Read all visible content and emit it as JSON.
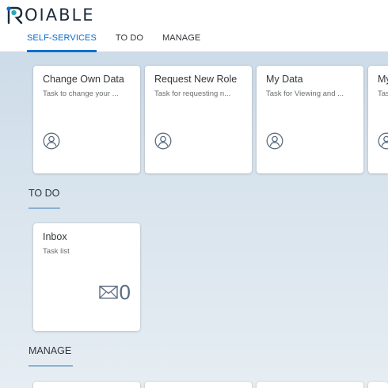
{
  "brand": {
    "logo_text": "OIABLE"
  },
  "tabs": [
    {
      "label": "SELF-SERVICES",
      "active": true
    },
    {
      "label": "TO DO",
      "active": false
    },
    {
      "label": "MANAGE",
      "active": false
    }
  ],
  "self_services": {
    "tiles": [
      {
        "title": "Change Own Data",
        "subtitle": "Task to change your ...",
        "icon": "user-icon"
      },
      {
        "title": "Request New Role",
        "subtitle": "Task for requesting n...",
        "icon": "user-icon"
      },
      {
        "title": "My Data",
        "subtitle": "Task for Viewing and ...",
        "icon": "user-icon"
      },
      {
        "title": "My",
        "subtitle": "Tas",
        "icon": "user-icon"
      }
    ]
  },
  "todo": {
    "heading": "TO DO",
    "inbox": {
      "title": "Inbox",
      "subtitle": "Task list",
      "count": "0",
      "icon": "envelope-icon"
    }
  },
  "manage": {
    "heading": "MANAGE"
  },
  "colors": {
    "accent": "#0a6ed1",
    "section_line": "#8eb0cf"
  }
}
